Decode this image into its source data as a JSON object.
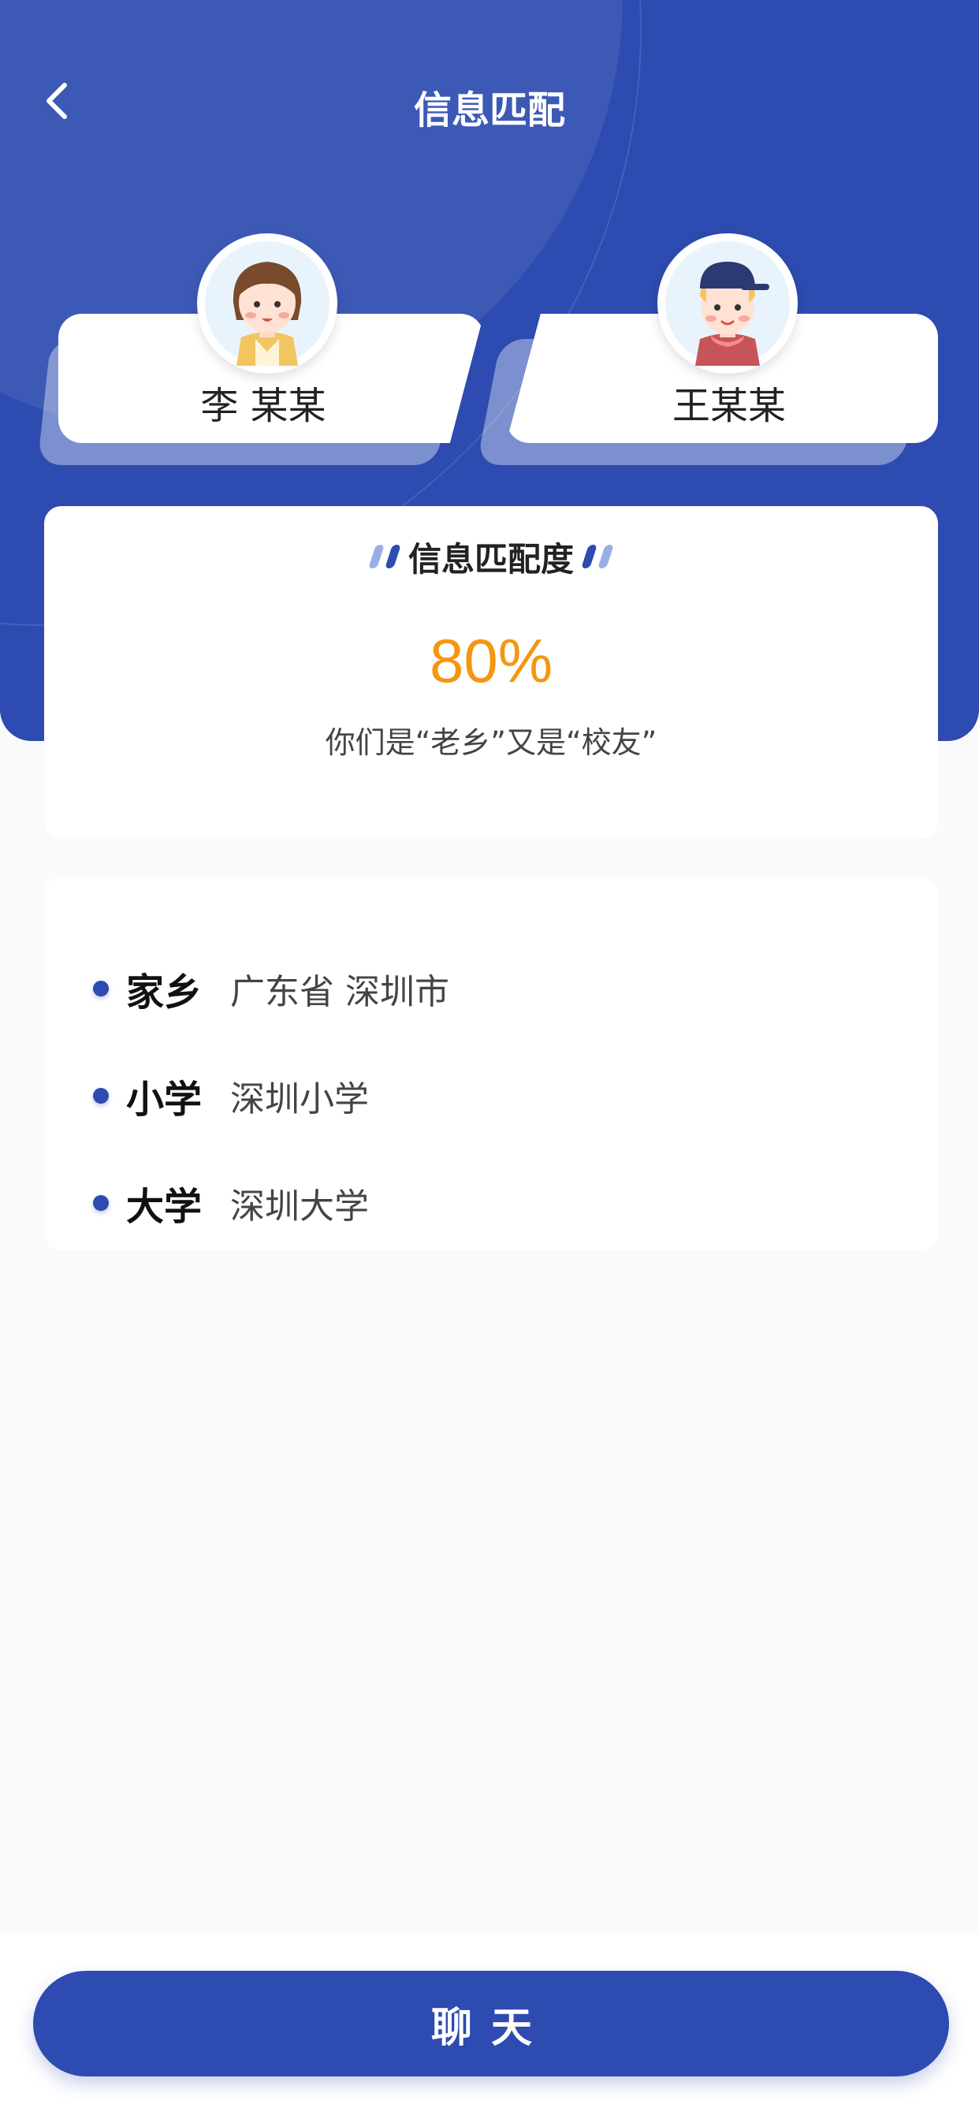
{
  "nav": {
    "title": "信息匹配",
    "back_icon": "chevron-left-icon"
  },
  "users": [
    {
      "name": "李 某某",
      "avatar": "avatar-female-icon"
    },
    {
      "name": "王某某",
      "avatar": "avatar-male-cap-icon"
    }
  ],
  "match": {
    "title": "信息匹配度",
    "percent": "80%",
    "percent_value": 0.8,
    "description": "你们是“老乡”又是“校友”"
  },
  "info": [
    {
      "label": "家乡",
      "value": "广东省 深圳市"
    },
    {
      "label": "小学",
      "value": "深圳小学"
    },
    {
      "label": "大学",
      "value": "深圳大学"
    }
  ],
  "action": {
    "chat_label": "聊天"
  },
  "colors": {
    "primary": "#2d4bb0",
    "accent": "#f5960f",
    "background": "#fafafa"
  }
}
